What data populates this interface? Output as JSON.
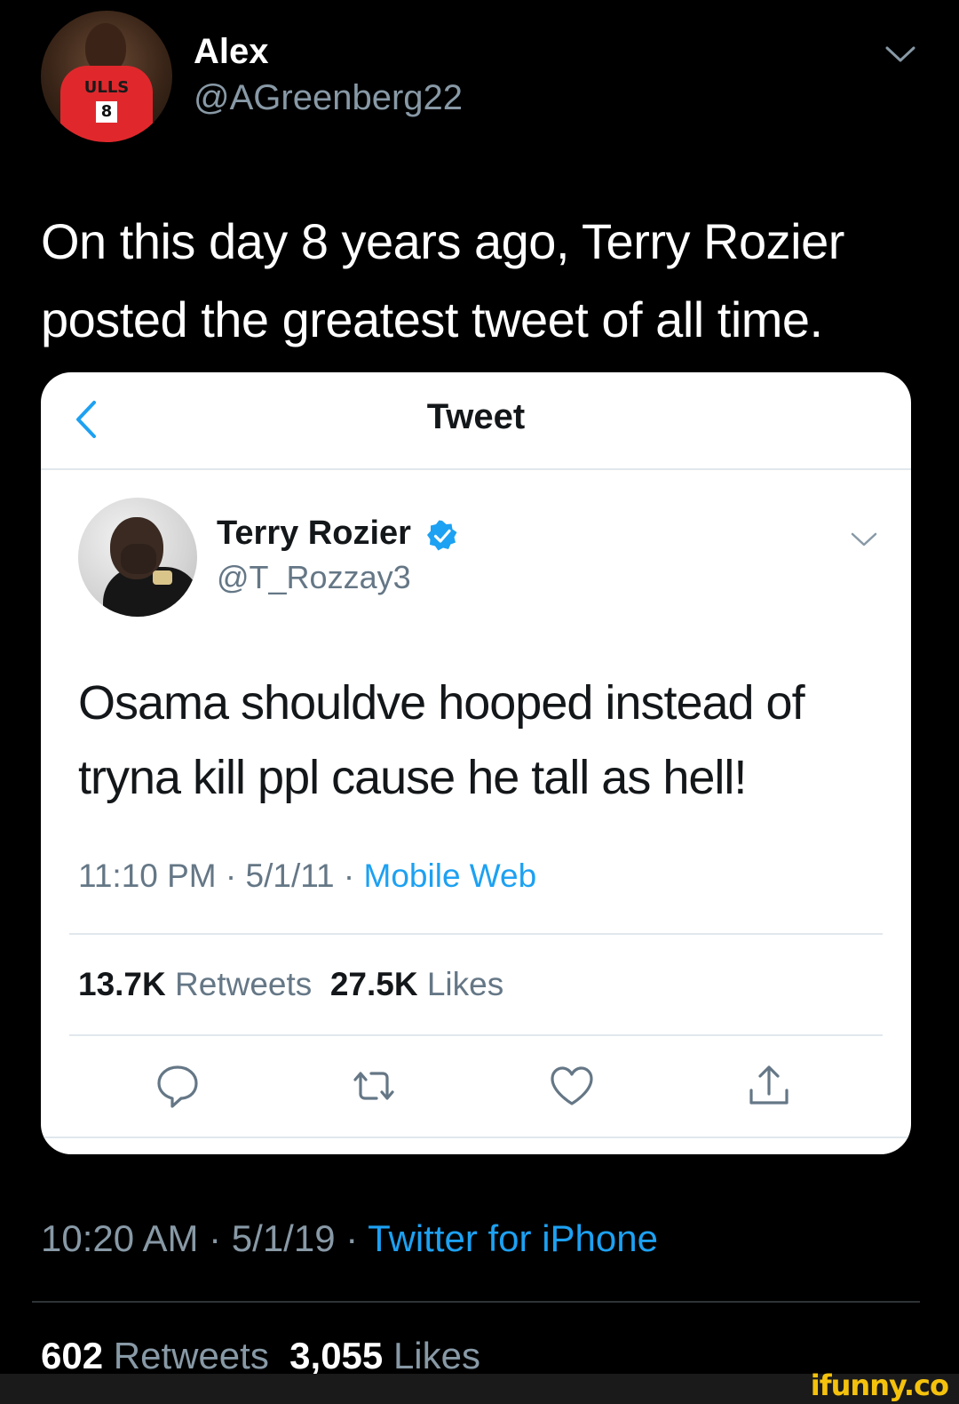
{
  "outer_tweet": {
    "name": "Alex",
    "handle": "@AGreenberg22",
    "text": "On this day 8 years ago, Terry Rozier posted the greatest tweet of all time.",
    "avatar_jersey_text": "ULLS",
    "avatar_jersey_number": "8",
    "time": "10:20 AM",
    "date": "5/1/19",
    "source": "Twitter for iPhone",
    "retweets": "602",
    "retweets_label": "Retweets",
    "likes": "3,055",
    "likes_label": "Likes",
    "sep": " · "
  },
  "embedded": {
    "header_title": "Tweet",
    "name": "Terry Rozier",
    "handle": "@T_Rozzay3",
    "text": "Osama shouldve hooped instead of tryna kill ppl cause he tall as hell!",
    "time": "11:10 PM",
    "date": "5/1/11",
    "source": "Mobile Web",
    "retweets": "13.7K",
    "retweets_label": "Retweets",
    "likes": "27.5K",
    "likes_label": "Likes",
    "sep": " · "
  },
  "watermark": "ifunny.co",
  "colors": {
    "background": "#000000",
    "link": "#1da1f2",
    "muted": "#8899a6",
    "card": "#ffffff"
  },
  "icons": [
    "chevron-down-icon",
    "back-arrow-icon",
    "verified-badge-icon",
    "reply-icon",
    "retweet-icon",
    "like-icon",
    "share-icon"
  ]
}
